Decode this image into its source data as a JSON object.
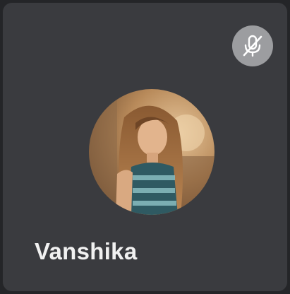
{
  "participant": {
    "name": "Vanshika",
    "avatar": "profile-photo",
    "mic_status_icon": "microphone-muted-icon"
  },
  "colors": {
    "background": "#242528",
    "tile": "#3a3b3f",
    "mute_button": "#9c9da0",
    "name_text": "#f1f1f1"
  }
}
